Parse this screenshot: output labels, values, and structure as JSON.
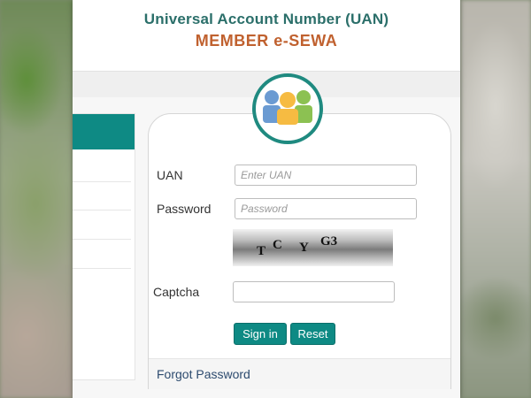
{
  "header": {
    "line1": "Universal Account Number (UAN)",
    "line2": "MEMBER e-SEWA",
    "line1_color": "#2b6f6a",
    "line2_color": "#c0612f"
  },
  "logo": {
    "icon": "members-group-icon",
    "ring_color": "#1f8a80"
  },
  "login": {
    "uan_label": "UAN",
    "uan_placeholder": "Enter UAN",
    "uan_value": "",
    "password_label": "Password",
    "password_placeholder": "Password",
    "password_value": "",
    "captcha_label": "Captcha",
    "captcha_chars": [
      "T",
      "C",
      "Y",
      "G3"
    ],
    "captcha_value": "",
    "signin_label": "Sign in",
    "reset_label": "Reset",
    "forgot_label": "Forgot Password"
  },
  "colors": {
    "accent": "#0e8a84"
  }
}
